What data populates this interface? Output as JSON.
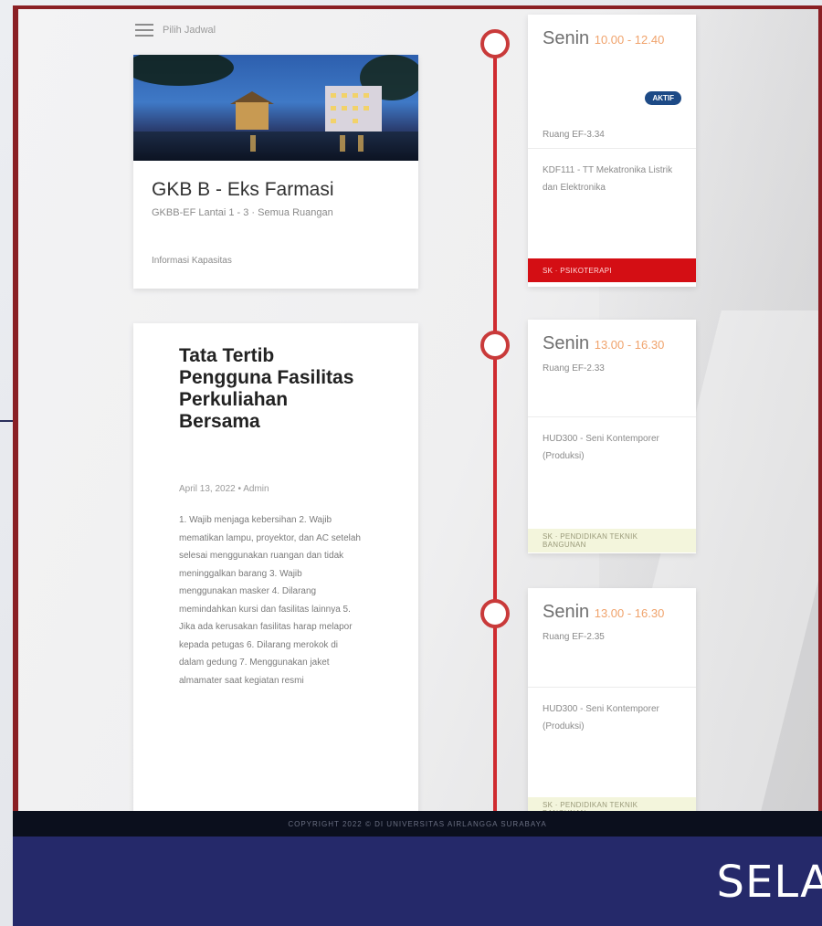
{
  "header": {
    "menu_label": "Pilih Jadwal"
  },
  "building": {
    "title": "GKB B - Eks Farmasi",
    "subtitle": "GKBB-EF Lantai 1 - 3 · Semua Ruangan",
    "info": "Informasi Kapasitas"
  },
  "rules": {
    "title": "Tata Tertib Pengguna Fasilitas Perkuliahan Bersama",
    "meta": "April 13, 2022 • Admin",
    "body": "1. Wajib menjaga kebersihan 2. Wajib mematikan lampu, proyektor, dan AC setelah selesai menggunakan ruangan dan tidak meninggalkan barang 3. Wajib menggunakan masker 4. Dilarang memindahkan kursi dan fasilitas lainnya 5. Jika ada kerusakan fasilitas harap melapor kepada petugas 6. Dilarang merokok di dalam gedung 7. Menggunakan jaket almamater saat kegiatan resmi"
  },
  "schedule": [
    {
      "day": "Senin",
      "time": "10.00 - 12.40",
      "room": "Ruang EF-3.34",
      "badge": "AKTIF",
      "course": "KDF111 - TT Mekatronika Listrik dan Elektronika",
      "status": "SK · PSIKOTERAPI",
      "status_color": "#d40e14"
    },
    {
      "day": "Senin",
      "time": "13.00 - 16.30",
      "room": "Ruang EF-2.33",
      "badge": "",
      "course": "HUD300 - Seni Kontemporer (Produksi)",
      "status": "SK · PENDIDIKAN TEKNIK BANGUNAN",
      "status_color": "#f3f5dc"
    },
    {
      "day": "Senin",
      "time": "13.00 - 16.30",
      "room": "Ruang EF-2.35",
      "badge": "",
      "course": "HUD300 - Seni Kontemporer (Produksi)",
      "status": "SK · PENDIDIKAN TEKNIK BANGUNAN",
      "status_color": "#f3f5dc"
    }
  ],
  "footer": {
    "copyright": "COPYRIGHT 2022 © DI UNIVERSITAS AIRLANGGA SURABAYA"
  },
  "banner": {
    "text": "SELA"
  },
  "colors": {
    "accent_red": "#cf2b30",
    "badge_blue": "#1d4a86",
    "banner_navy": "#25296a",
    "time_orange": "#f0a36c"
  }
}
